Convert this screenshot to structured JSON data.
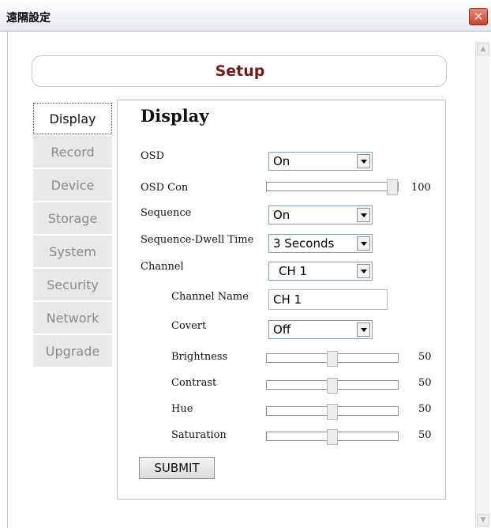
{
  "window": {
    "title": "遠隔設定",
    "close_glyph": "✕"
  },
  "header": {
    "title": "Setup"
  },
  "sidebar": {
    "items": [
      {
        "label": "Display",
        "active": true
      },
      {
        "label": "Record"
      },
      {
        "label": "Device"
      },
      {
        "label": "Storage"
      },
      {
        "label": "System"
      },
      {
        "label": "Security"
      },
      {
        "label": "Network"
      },
      {
        "label": "Upgrade"
      }
    ]
  },
  "display": {
    "title": "Display",
    "osd": {
      "label": "OSD",
      "value": "On"
    },
    "osd_con": {
      "label": "OSD Con",
      "value": "100",
      "level": 100
    },
    "sequence": {
      "label": "Sequence",
      "value": "On"
    },
    "sequence_dwell": {
      "label": "Sequence-Dwell Time",
      "value": "3 Seconds"
    },
    "channel": {
      "label": "Channel",
      "value": "CH 1"
    },
    "channel_name": {
      "label": "Channel Name",
      "value": "CH 1"
    },
    "covert": {
      "label": "Covert",
      "value": "Off"
    },
    "brightness": {
      "label": "Brightness",
      "value": "50",
      "level": 50
    },
    "contrast": {
      "label": "Contrast",
      "value": "50",
      "level": 50
    },
    "hue": {
      "label": "Hue",
      "value": "50",
      "level": 50
    },
    "saturation": {
      "label": "Saturation",
      "value": "50",
      "level": 50
    },
    "submit_label": "SUBMIT"
  },
  "colors": {
    "accent_title": "#7a1a12",
    "close_button": "#c8452e"
  },
  "icons": {
    "close": "close-icon",
    "dropdown": "chevron-down-icon",
    "scroll_up": "scroll-up-arrow-icon",
    "scroll_down": "scroll-down-arrow-icon"
  }
}
